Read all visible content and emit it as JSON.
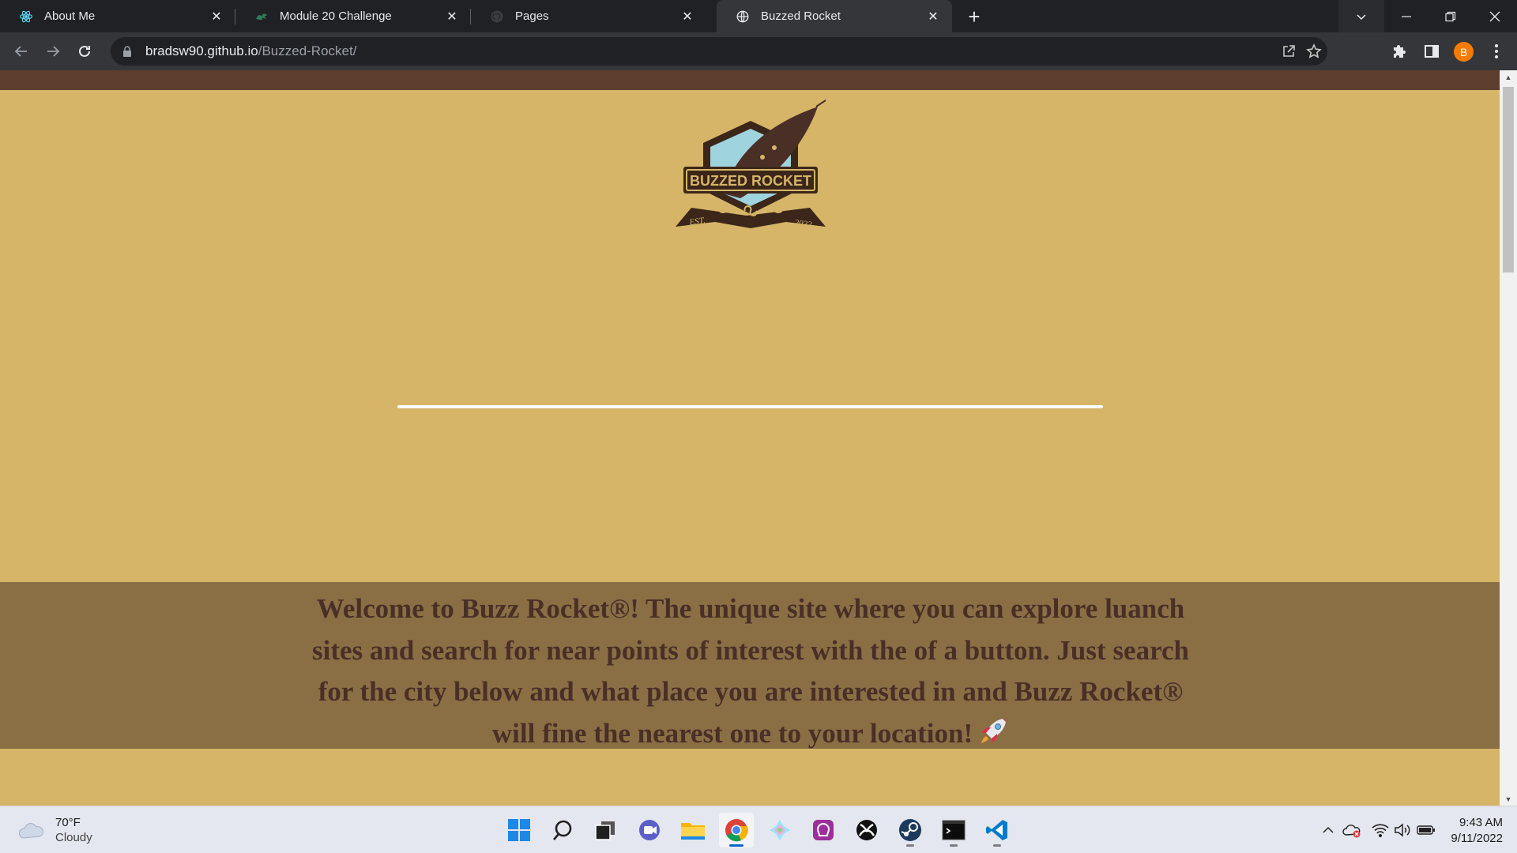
{
  "browser": {
    "tabs": [
      {
        "title": "About Me",
        "icon": "react-icon",
        "active": false
      },
      {
        "title": "Module 20 Challenge",
        "icon": "dragon-icon",
        "active": false
      },
      {
        "title": "Pages",
        "icon": "github-icon",
        "active": false
      },
      {
        "title": "Buzzed Rocket",
        "icon": "globe-icon",
        "active": true
      }
    ],
    "url_host": "bradsw90.github.io",
    "url_path": "/Buzzed-Rocket/",
    "profile_initial": "B"
  },
  "page": {
    "logo": {
      "name": "BUZZED ROCKET",
      "est": "EST.",
      "year": "2022"
    },
    "welcome_text": "Welcome to Buzz Rocket®! The unique site where you can explore luanch sites and search for near points of interest with the of a button. Just search for the city below and what place you are interested in and Buzz Rocket® will fine the nearest one to your location!",
    "colors": {
      "background": "#d6b568",
      "top_bar": "#5c3d2e",
      "band": "#8a6f45",
      "text": "#4a2f27"
    }
  },
  "taskbar": {
    "weather": {
      "temp": "70°F",
      "condition": "Cloudy"
    },
    "apps": [
      "start",
      "search",
      "task-view",
      "teams-chat",
      "file-explorer",
      "chrome",
      "gitkraken",
      "app-icon",
      "xbox",
      "steam",
      "terminal",
      "vscode"
    ],
    "time": "9:43 AM",
    "date": "9/11/2022"
  }
}
